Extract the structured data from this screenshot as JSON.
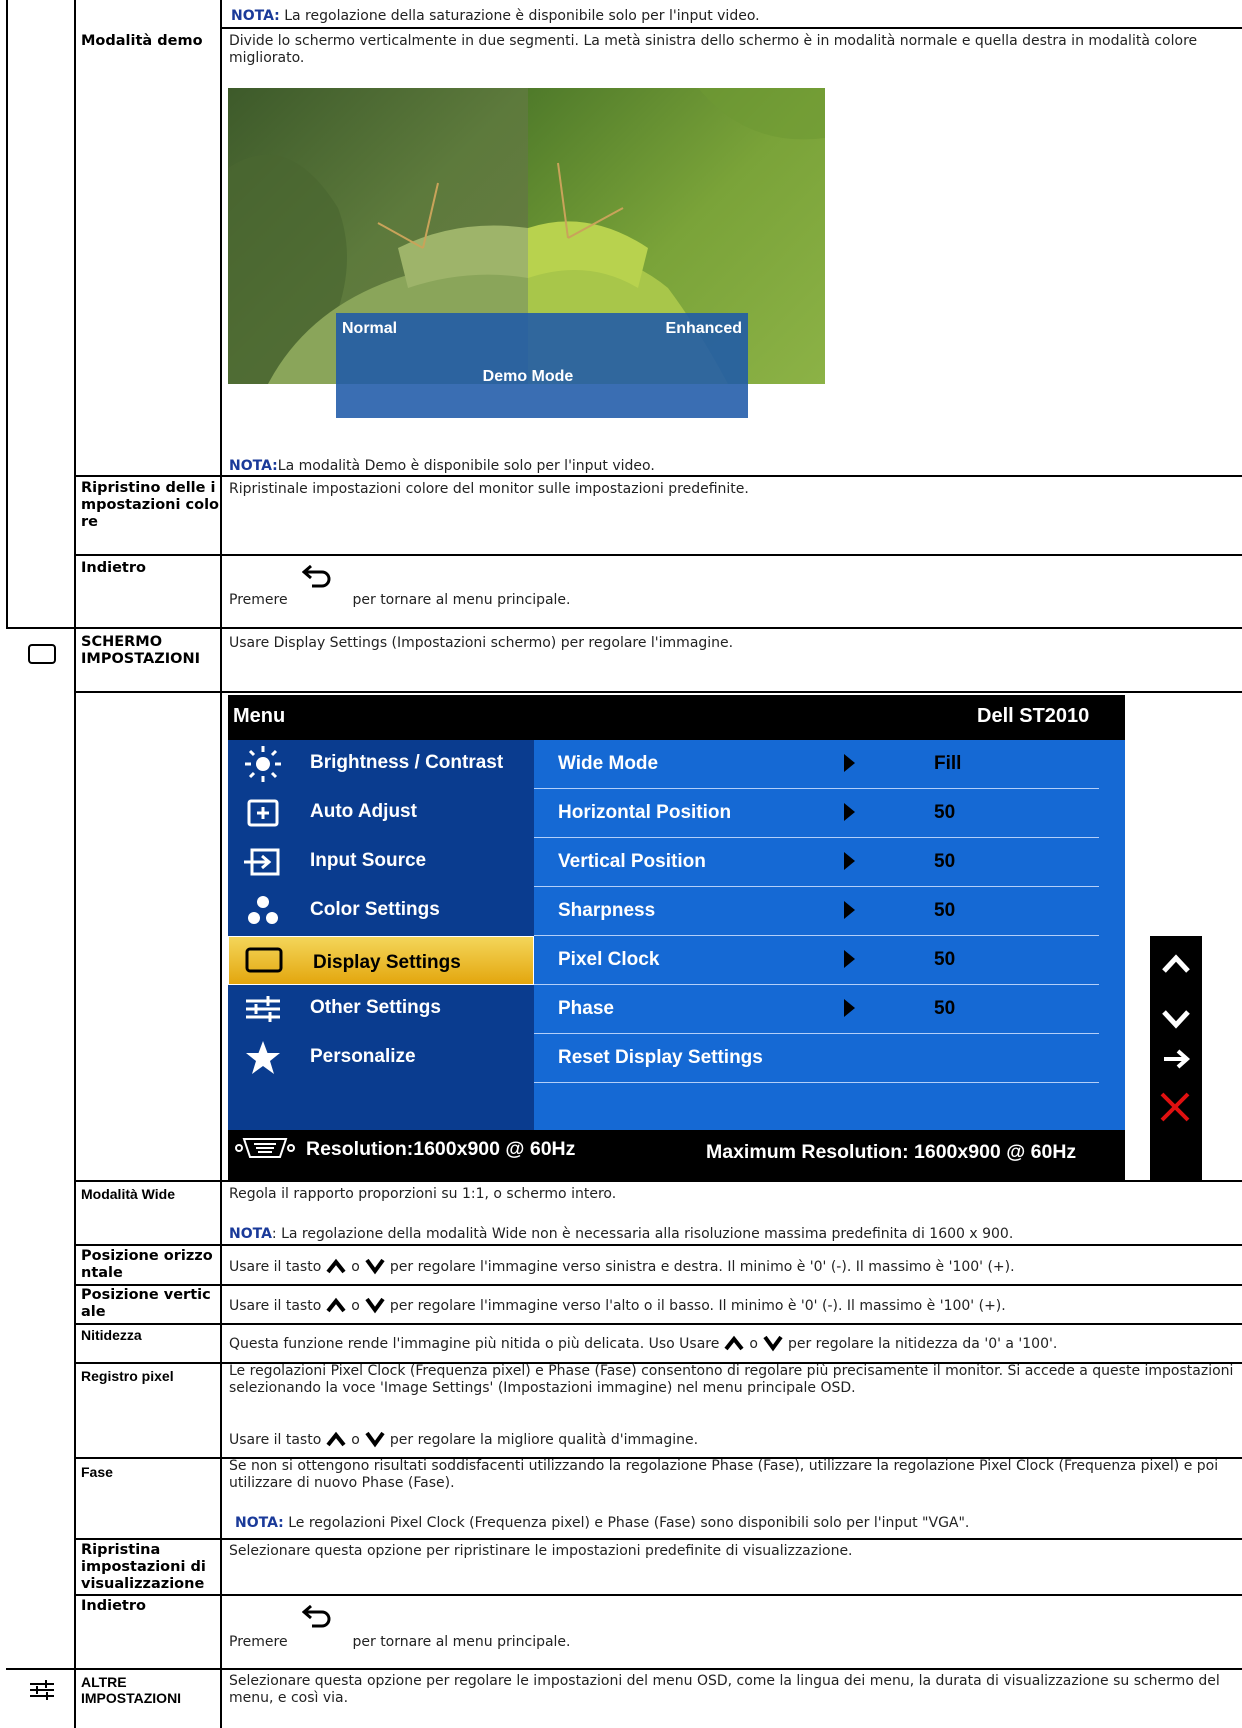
{
  "saturation_note": {
    "key": "NOTA:",
    "text": " La regolazione della saturazione è disponibile solo per l'input video."
  },
  "color_rows": {
    "demo_label": "Modalità demo",
    "demo_desc": "Divide lo schermo verticalmente in due segmenti. La metà sinistra dello schermo è in modalità normale e quella destra in modalità colore migliorato.",
    "demo_image": {
      "normal": "Normal",
      "enhanced": "Enhanced",
      "caption": "Demo  Mode"
    },
    "demo_note": {
      "key": "NOTA:",
      "text": "La modalità Demo è disponibile solo per l'input video."
    },
    "reset_label": "Ripristino delle impostazioni colore",
    "reset_desc": "Ripristinale impostazioni colore del monitor sulle impostazioni predefinite.",
    "back_label": "Indietro",
    "back_pre": "Premere",
    "back_post": "per tornare al menu principale."
  },
  "display_section": {
    "label": "SCHERMO IMPOSTAZIONI",
    "desc": "Usare Display Settings (Impostazioni schermo) per regolare l'immagine."
  },
  "osd": {
    "title": "Menu",
    "model": "Dell ST2010",
    "menu_items": [
      "Brightness / Contrast",
      "Auto Adjust",
      "Input Source",
      "Color Settings",
      "Display Settings",
      "Other Settings",
      "Personalize"
    ],
    "settings": [
      {
        "name": "Wide Mode",
        "value": "Fill"
      },
      {
        "name": "Horizontal Position",
        "value": "50"
      },
      {
        "name": "Vertical Position",
        "value": "50"
      },
      {
        "name": "Sharpness",
        "value": "50"
      },
      {
        "name": "Pixel Clock",
        "value": "50"
      },
      {
        "name": "Phase",
        "value": "50"
      },
      {
        "name": "Reset Display Settings",
        "value": ""
      }
    ],
    "resolution": "Resolution:1600x900 @ 60Hz",
    "max_resolution": "Maximum Resolution: 1600x900 @ 60Hz"
  },
  "rows": {
    "wide_label": "Modalità Wide",
    "wide_desc": "Regola il rapporto proporzioni su 1:1, o schermo intero.",
    "wide_note_key": "NOTA",
    "wide_note": ": La regolazione della modalità Wide non è necessaria alla risoluzione massima predefinita di 1600 x 900.",
    "hpos_label": "Posizione orizzontale",
    "hpos_pre": "Usare il tasto",
    "hpos_or": "o",
    "hpos_post": "per regolare l'immagine verso sinistra e destra. Il minimo è '0' (-). Il massimo è '100' (+).",
    "vpos_label": "Posizione verticale",
    "vpos_pre": "Usare il tasto",
    "vpos_or": "o",
    "vpos_post": "per regolare l'immagine verso l'alto o il basso. Il minimo è '0' (-). Il massimo è '100' (+).",
    "sharp_label": "Nitidezza",
    "sharp_pre": "Questa funzione rende l'immagine più nitida o più delicata. Uso Usare",
    "sharp_or": "o",
    "sharp_post": "per regolare la nitidezza da '0' a '100'.",
    "pixel_label": "Registro pixel",
    "pixel_desc": "Le regolazioni Pixel Clock (Frequenza pixel) e Phase (Fase) consentono di regolare più precisamente il monitor. Si accede a queste impostazioni selezionando la voce 'Image Settings' (Impostazioni immagine) nel menu principale OSD.",
    "pixel_pre": "Usare il tasto",
    "pixel_or": "o",
    "pixel_post": "per regolare la migliore qualità d'immagine.",
    "phase_label": "Fase",
    "phase_desc": "Se non si ottengono risultati soddisfacenti utilizzando la regolazione Phase (Fase), utilizzare la regolazione Pixel Clock (Frequenza pixel) e poi utilizzare di nuovo Phase (Fase).",
    "phase_note_key": "NOTA:",
    "phase_note": " Le regolazioni Pixel Clock (Frequenza pixel) e Phase (Fase) sono disponibili solo per l'input \"VGA\".",
    "reset_display_label": "Ripristina impostazioni di visualizzazione",
    "reset_display_desc": "Selezionare questa opzione per ripristinare le impostazioni predefinite di visualizzazione.",
    "back_label": "Indietro",
    "back_pre": "Premere",
    "back_post": "per tornare al menu principale."
  },
  "other_section": {
    "label": "ALTRE IMPOSTAZIONI",
    "desc": "Selezionare questa opzione per regolare le impostazioni del menu OSD, come la lingua dei menu, la durata di visualizzazione su schermo del menu, e così via."
  },
  "icons": [
    "display-settings-icon",
    "other-settings-icon",
    "back-arrow-icon",
    "up-arrow-icon",
    "down-arrow-icon"
  ]
}
